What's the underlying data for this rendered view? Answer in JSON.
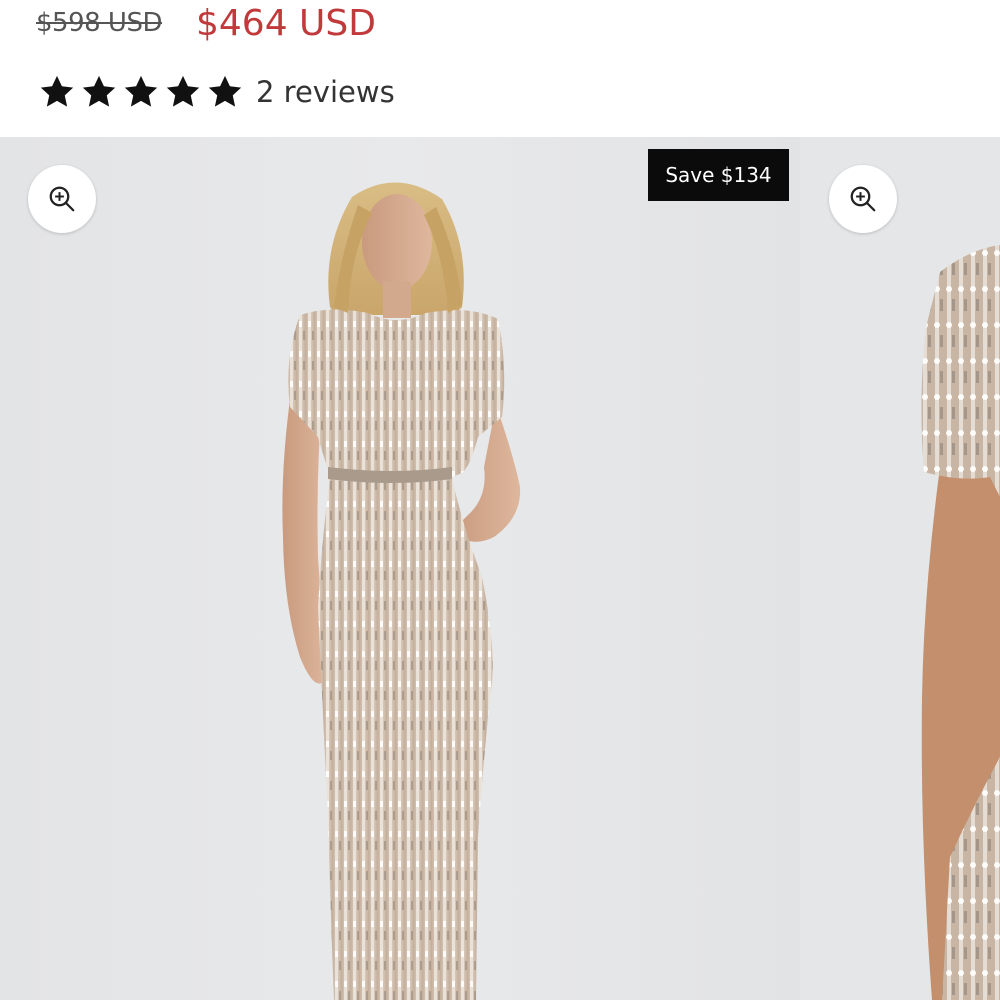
{
  "product": {
    "price_original": "$598 USD",
    "price_sale": "$464 USD",
    "rating_stars": 5,
    "reviews_label": "2 reviews"
  },
  "gallery": {
    "save_badge": "Save $134",
    "slides": [
      {
        "name": "gallery-slide-front",
        "zoom_icon": "zoom-in-icon"
      },
      {
        "name": "gallery-slide-detail",
        "zoom_icon": "zoom-in-icon"
      }
    ]
  },
  "colors": {
    "sale_price": "#c1393b",
    "original_price": "#555555",
    "badge_bg": "#0b0b0b",
    "gallery_bg": "#e4e5e7"
  }
}
